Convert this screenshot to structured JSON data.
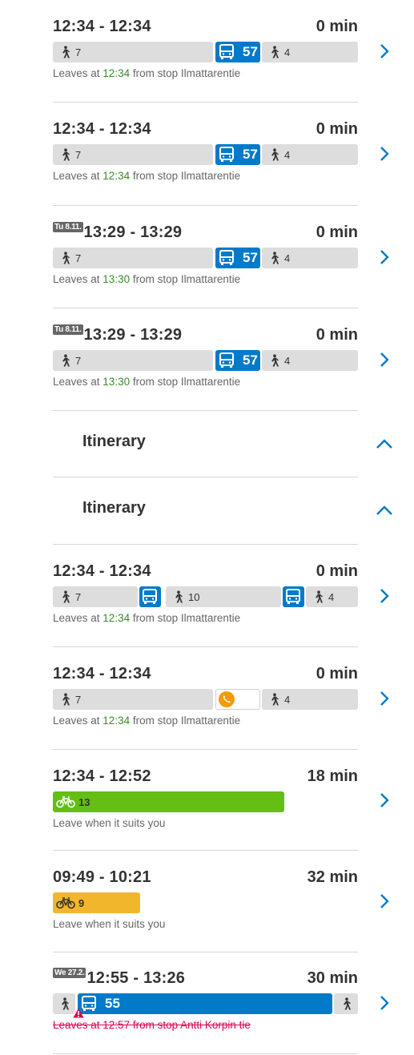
{
  "itineraries": [
    {
      "time": "12:34 - 12:34",
      "duration": "0 min",
      "walk1": "7",
      "bus": "57",
      "walk2": "4",
      "leave_prefix": "Leaves at ",
      "leave_time": "12:34",
      "leave_suffix": " from stop Ilmattarentie"
    },
    {
      "time": "12:34 - 12:34",
      "duration": "0 min",
      "walk1": "7",
      "bus": "57",
      "walk2": "4",
      "leave_prefix": "Leaves at ",
      "leave_time": "12:34",
      "leave_suffix": " from stop Ilmattarentie"
    },
    {
      "day": "Tu 8.11.",
      "time": "13:29 - 13:29",
      "duration": "0 min",
      "walk1": "7",
      "bus": "57",
      "walk2": "4",
      "leave_prefix": "Leaves at ",
      "leave_time": "13:30",
      "leave_suffix": " from stop Ilmattarentie"
    },
    {
      "day": "Tu 8.11.",
      "time": "13:29 - 13:29",
      "duration": "0 min",
      "walk1": "7",
      "bus": "57",
      "walk2": "4",
      "leave_prefix": "Leaves at ",
      "leave_time": "13:30",
      "leave_suffix": " from stop Ilmattarentie"
    }
  ],
  "itinerary_headers": [
    "Itinerary",
    "Itinerary"
  ],
  "itineraries2": [
    {
      "time": "12:34 - 12:34",
      "duration": "0 min",
      "walk1": "7",
      "walk_mid": "10",
      "walk2": "4",
      "leave_prefix": "Leaves at ",
      "leave_time": "12:34",
      "leave_suffix": " from stop Ilmattarentie"
    },
    {
      "time": "12:34 - 12:34",
      "duration": "0 min",
      "walk1": "7",
      "walk2": "4",
      "leave_prefix": "Leaves at ",
      "leave_time": "12:34",
      "leave_suffix": " from stop Ilmattarentie"
    },
    {
      "time": "12:34 - 12:52",
      "duration": "18 min",
      "bike": "13",
      "leave_text": "Leave when it suits you"
    },
    {
      "time": "09:49 - 10:21",
      "duration": "32 min",
      "citybike": "9",
      "leave_text": "Leave when it suits you"
    },
    {
      "day": "We 27.2.",
      "time": "12:55 - 13:26",
      "duration": "30 min",
      "bus": "55",
      "leave_cancelled": "Leaves at 12:57 from stop Antti Korpin tie"
    }
  ],
  "colors": {
    "bus": "#007ac9",
    "walk": "#dddddd",
    "bike": "#64be14",
    "citybike": "#f2b62d",
    "call": "#f59a00",
    "time_green": "#3a8a28",
    "alert": "#dc0451"
  }
}
